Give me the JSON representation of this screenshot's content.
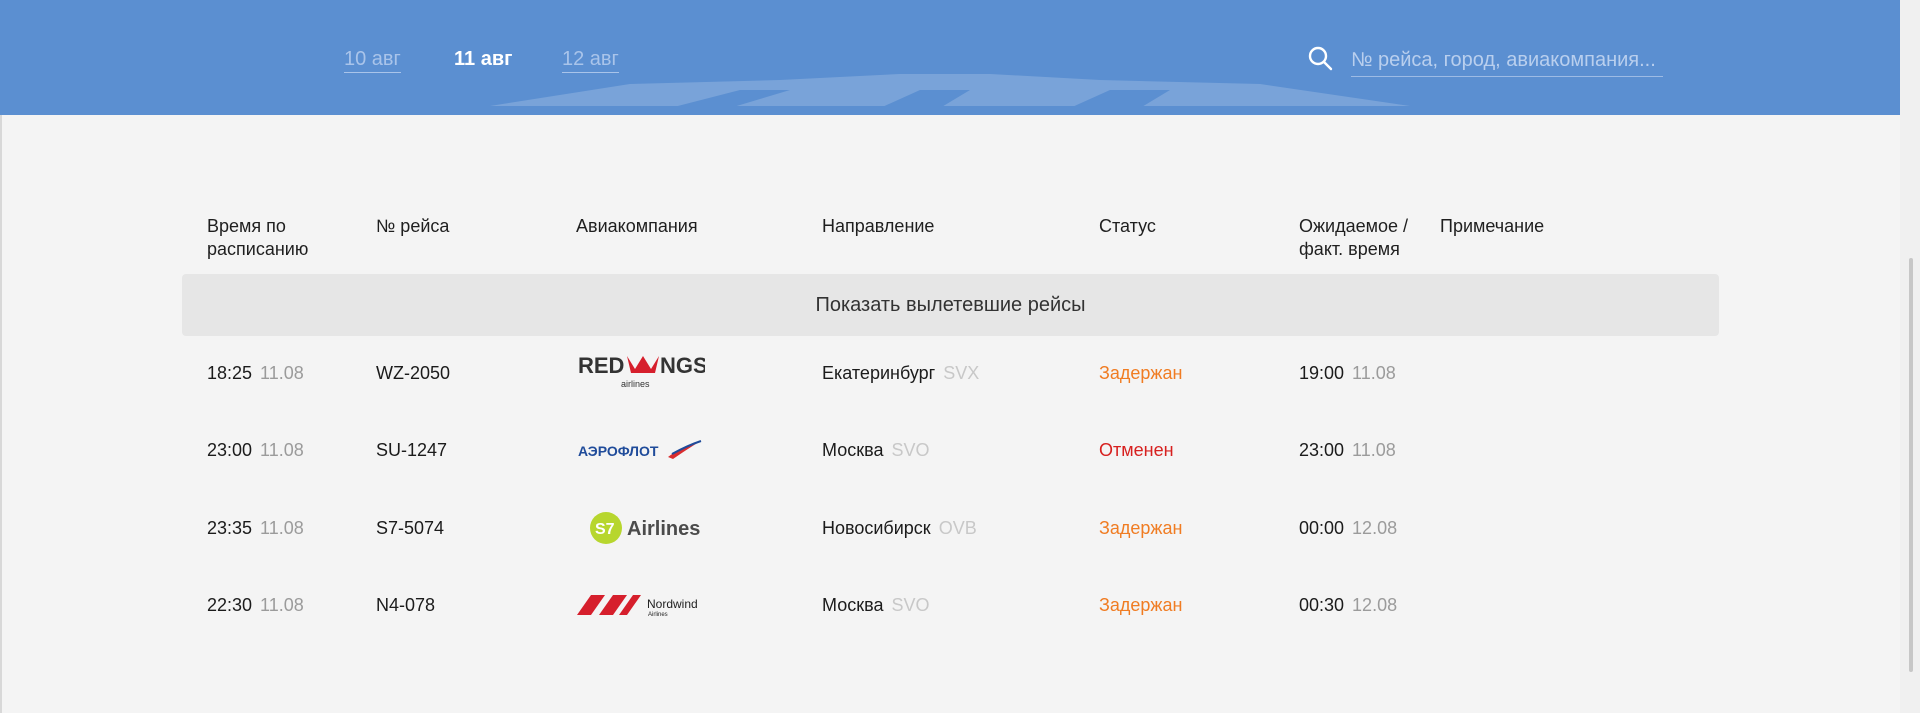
{
  "header": {
    "dates": [
      {
        "label": "10 авг",
        "active": false
      },
      {
        "label": "11 авг",
        "active": true
      },
      {
        "label": "12 авг",
        "active": false
      }
    ],
    "search": {
      "placeholder": "№ рейса, город, авиакомпания..."
    }
  },
  "table": {
    "headers": {
      "scheduled": "Время по\nрасписанию",
      "flight": "№ рейса",
      "airline": "Авиакомпания",
      "direction": "Направление",
      "status": "Статус",
      "expected": "Ожидаемое /\nфакт. время",
      "note": "Примечание"
    },
    "show_departed": "Показать вылетевшие рейсы",
    "rows": [
      {
        "scheduled_time": "18:25",
        "scheduled_date": "11.08",
        "flight": "WZ-2050",
        "airline": "redwings-logo",
        "city": "Екатеринбург",
        "airport": "SVX",
        "status": "Задержан",
        "status_color": "#f07c22",
        "expected_time": "19:00",
        "expected_date": "11.08"
      },
      {
        "scheduled_time": "23:00",
        "scheduled_date": "11.08",
        "flight": "SU-1247",
        "airline": "aeroflot-logo",
        "city": "Москва",
        "airport": "SVO",
        "status": "Отменен",
        "status_color": "#d7201f",
        "expected_time": "23:00",
        "expected_date": "11.08"
      },
      {
        "scheduled_time": "23:35",
        "scheduled_date": "11.08",
        "flight": "S7-5074",
        "airline": "s7-logo",
        "city": "Новосибирск",
        "airport": "OVB",
        "status": "Задержан",
        "status_color": "#f07c22",
        "expected_time": "00:00",
        "expected_date": "12.08"
      },
      {
        "scheduled_time": "22:30",
        "scheduled_date": "11.08",
        "flight": "N4-078",
        "airline": "nordwind-logo",
        "city": "Москва",
        "airport": "SVO",
        "status": "Задержан",
        "status_color": "#f07c22",
        "expected_time": "00:30",
        "expected_date": "12.08"
      }
    ]
  },
  "logos": {
    "redwings": {
      "text_left": "RED",
      "text_right": "NGS",
      "sub": "airlines"
    },
    "aeroflot": {
      "text": "АЭРОФЛОТ"
    },
    "s7": {
      "badge": "S7",
      "text": "Airlines"
    },
    "nordwind": {
      "title": "Nordwind",
      "sub": "Airlines"
    }
  },
  "colors": {
    "header_bg": "#5b8fd1",
    "delayed": "#f07c22",
    "cancelled": "#d7201f"
  }
}
